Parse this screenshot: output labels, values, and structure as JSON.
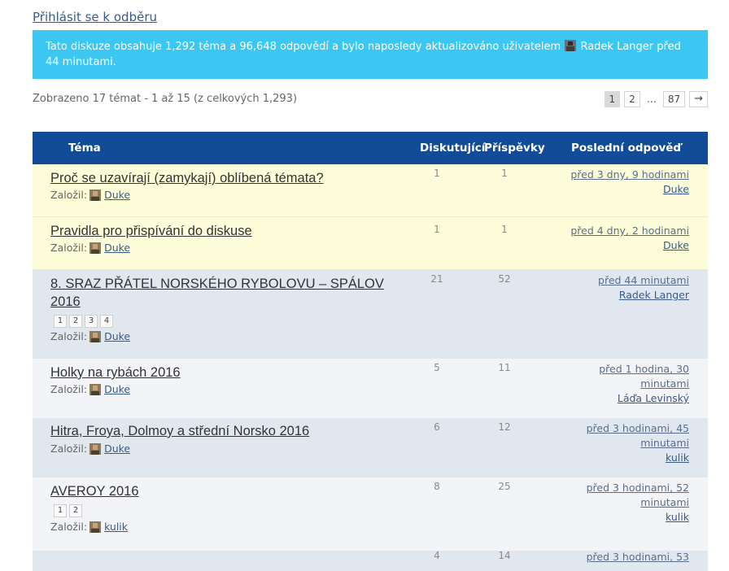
{
  "subscribe_label": "Přihlásit se k odběru",
  "info": {
    "text_before": "Tato diskuze obsahuje 1,292 téma a 96,648 odpovědí a bylo naposledy aktualizováno uživatelem",
    "user": "Radek Langer",
    "text_after": "před 44 minutami."
  },
  "count_text": "Zobrazeno 17 témat - 1 až 15 (z celkových 1,293)",
  "pagination": {
    "pages": [
      "1",
      "2"
    ],
    "dots": "…",
    "last": "87",
    "next": "→"
  },
  "headers": {
    "topic": "Téma",
    "participants": "Diskutující",
    "posts": "Příspěvky",
    "last_reply": "Poslední odpověď"
  },
  "author_label": "Založil:",
  "topics": [
    {
      "title": "Proč se uzavírají (zamykají) oblíbená témata?",
      "author": "Duke",
      "participants": "1",
      "posts": "1",
      "last_when": "před 3 dny, 9 hodinami",
      "last_by": "Duke",
      "sticky": true
    },
    {
      "title": "Pravidla pro přispívání do diskuse",
      "author": "Duke",
      "participants": "1",
      "posts": "1",
      "last_when": "před 4 dny, 2 hodinami",
      "last_by": "Duke",
      "sticky": true
    },
    {
      "title": "8. SRAZ PŘÁTEL NORSKÉHO RYBOLOVU – SPÁLOV 2016",
      "author": "Duke",
      "participants": "21",
      "posts": "52",
      "last_when": "před 44 minutami",
      "last_by": "Radek Langer",
      "pages": [
        "1",
        "2",
        "3",
        "4"
      ]
    },
    {
      "title": "Holky na rybách 2016",
      "author": "Duke",
      "participants": "5",
      "posts": "11",
      "last_when": "před 1 hodina, 30 minutami",
      "last_by": "Láďa Levinský"
    },
    {
      "title": "Hitra, Froya, Dolmoy a střední Norsko 2016",
      "author": "Duke",
      "participants": "6",
      "posts": "12",
      "last_when": "před 3 hodinami, 45 minutami",
      "last_by": "kulik"
    },
    {
      "title": "AVEROY 2016",
      "author": "kulik",
      "participants": "8",
      "posts": "25",
      "last_when": "před 3 hodinami, 52 minutami",
      "last_by": "kulik",
      "pages": [
        "1",
        "2"
      ]
    },
    {
      "title": "",
      "author": "",
      "participants": "4",
      "posts": "14",
      "last_when": "před 3 hodinami, 53",
      "last_by": ""
    }
  ],
  "colors": {
    "info_bg": "#3cc6f2",
    "header_bg": "#124c99",
    "sticky_bg": "#fdfdd9",
    "row_odd": "#e1e7ef",
    "row_even": "#f2f4f8",
    "link": "#3a5a87"
  }
}
